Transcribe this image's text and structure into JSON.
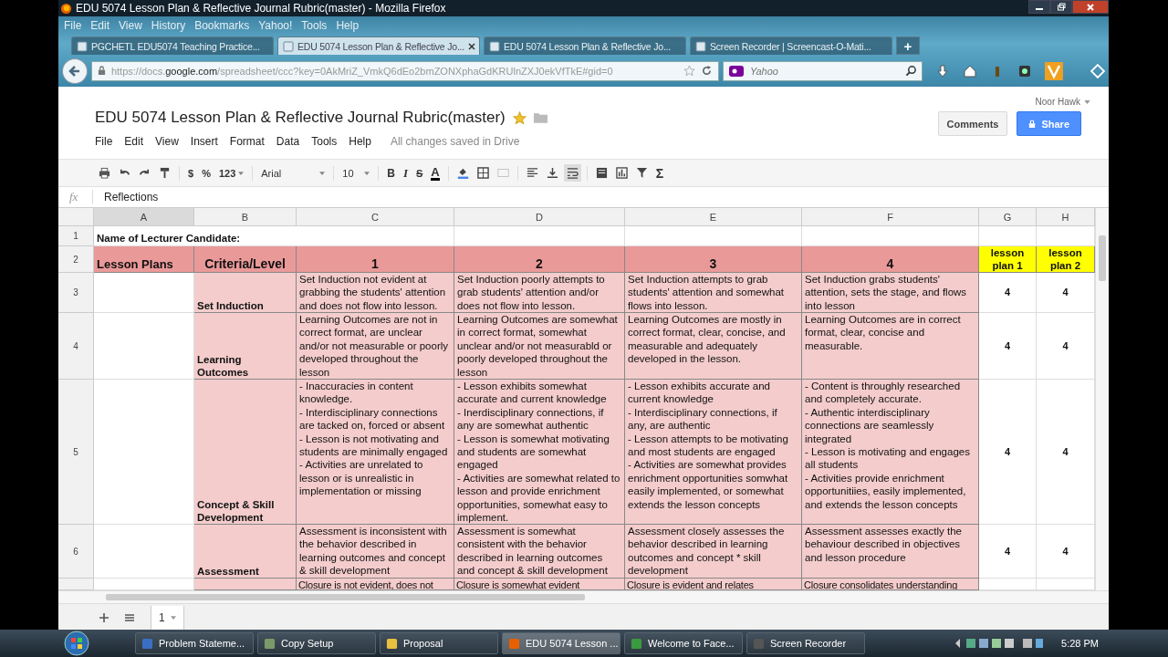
{
  "window": {
    "title": "EDU 5074 Lesson Plan & Reflective Journal Rubric(master) - Mozilla Firefox"
  },
  "menu": [
    "File",
    "Edit",
    "View",
    "History",
    "Bookmarks",
    "Yahoo!",
    "Tools",
    "Help"
  ],
  "tabs": [
    {
      "label": "PGCHETL EDU5074 Teaching Practice...",
      "selected": false
    },
    {
      "label": "EDU 5074 Lesson Plan & Reflective Jo...",
      "selected": true
    },
    {
      "label": "EDU 5074 Lesson Plan & Reflective Jo...",
      "selected": false
    },
    {
      "label": "Screen Recorder | Screencast-O-Mati...",
      "selected": false
    }
  ],
  "new_tab": "+",
  "url": "https://docs.**google.com**/spreadsheet/ccc?key=0AkMriZ_VmkQ6dEo2bmZONXphaGdKRUlnZXJ0ekVfTkE#gid=0",
  "search": {
    "placeholder": "Yahoo"
  },
  "doc": {
    "title": "EDU 5074 Lesson Plan & Reflective Journal Rubric(master)",
    "starred": true,
    "user": "Noor Hawk",
    "menus": [
      "File",
      "Edit",
      "View",
      "Insert",
      "Format",
      "Data",
      "Tools",
      "Help"
    ],
    "save_status": "All changes saved in Drive",
    "comments": "Comments",
    "share": "Share"
  },
  "toolbar": {
    "currency": "$",
    "percent": "%",
    "number_format": "123",
    "font": "Arial",
    "size": "10",
    "bold": "B",
    "italic": "I",
    "strike": "S",
    "text_color": "A",
    "functions": "Σ"
  },
  "formula": {
    "label": "fx",
    "value": "Reflections"
  },
  "columns": [
    {
      "label": "A",
      "selected": true
    },
    {
      "label": "B",
      "selected": false
    },
    {
      "label": "C",
      "selected": false
    },
    {
      "label": "D",
      "selected": false
    },
    {
      "label": "E",
      "selected": false
    },
    {
      "label": "F",
      "selected": false
    },
    {
      "label": "G",
      "selected": false
    },
    {
      "label": "H",
      "selected": false
    }
  ],
  "rows": [
    {
      "number": "1",
      "cells": [
        {
          "text": "Name of Lecturer Candidate:",
          "kind": "title"
        },
        null,
        null,
        null,
        null,
        null,
        null,
        null
      ]
    },
    {
      "number": "2",
      "cells": [
        {
          "text": "Lesson Plans",
          "kind": "head-left"
        },
        {
          "text": "Criteria/Level",
          "kind": "head"
        },
        {
          "text": "1",
          "kind": "head"
        },
        {
          "text": "2",
          "kind": "head"
        },
        {
          "text": "3",
          "kind": "head"
        },
        {
          "text": "4",
          "kind": "head"
        },
        {
          "text": "lesson plan 1",
          "kind": "tag"
        },
        {
          "text": "lesson plan 2",
          "kind": "tag"
        }
      ]
    },
    {
      "number": "3",
      "cells": [
        null,
        {
          "text": "Set Induction",
          "kind": "crit"
        },
        {
          "text": "Set Induction not evident at grabbing the students' attention and does not flow into lesson.",
          "kind": "desc"
        },
        {
          "text": "Set Induction poorly attempts to grab students' attention and/or does not flow into lesson.",
          "kind": "desc"
        },
        {
          "text": "Set Induction attempts to grab students' attention and somewhat flows into lesson.",
          "kind": "desc"
        },
        {
          "text": "Set Induction grabs students' attention, sets the stage, and flows into lesson",
          "kind": "desc"
        },
        {
          "text": "4",
          "kind": "score"
        },
        {
          "text": "4",
          "kind": "score"
        }
      ]
    },
    {
      "number": "4",
      "cells": [
        null,
        {
          "text": "Learning Outcomes",
          "kind": "crit"
        },
        {
          "text": "Learning Outcomes are not in correct format, are unclear and/or not measurable or poorly developed throughout the lesson",
          "kind": "desc"
        },
        {
          "text": "Learning Outcomes are somewhat in correct format, somewhat unclear and/or not measurabld or poorly developed throughout the lesson",
          "kind": "desc"
        },
        {
          "text": "Learning Outcomes are mostly in correct format, clear, concise, and measurable and adequately developed in the lesson.",
          "kind": "desc"
        },
        {
          "text": "Learning Outcomes are in correct format, clear, concise and measurable.",
          "kind": "desc"
        },
        {
          "text": "4",
          "kind": "score"
        },
        {
          "text": "4",
          "kind": "score"
        }
      ]
    },
    {
      "number": "5",
      "cells": [
        null,
        {
          "text": "Concept & Skill Development",
          "kind": "crit"
        },
        {
          "text": "- Inaccuracies in content knowledge.\n- Interdisciplinary connections are tacked on, forced or absent\n- Lesson is not motivating and students are minimally engaged\n- Activities are unrelated to lesson or is unrealistic in implementation or missing",
          "kind": "desc"
        },
        {
          "text": "- Lesson exhibits somewhat accurate and current knowledge\n- Inerdisciplinary connections, if any are somewhat authentic\n- Lesson is somewhat motivating and students are somewhat engaged\n- Activities are somewhat related to lesson and provide enrichment opportunities, somewhat easy to implement.",
          "kind": "desc"
        },
        {
          "text": "- Lesson exhibits accurate and current knowledge\n- Interdisciplinary connections, if any, are authentic\n- Lesson attempts to be motivating and most students are engaged\n- Activities are somewhat provides enrichment opportunities somwhat easily implemented, or somewhat extends the lesson concepts",
          "kind": "desc"
        },
        {
          "text": "- Content is throughly researched and completely accurate.\n- Authentic interdisciplinary connections are seamlessly integrated\n- Lesson is motivating and engages all students\n- Activities provide enrichment opportunitiies, easily implemented, and extends the lesson concepts",
          "kind": "desc"
        },
        {
          "text": "4",
          "kind": "score"
        },
        {
          "text": "4",
          "kind": "score"
        }
      ]
    },
    {
      "number": "6",
      "cells": [
        null,
        {
          "text": "Assessment",
          "kind": "crit"
        },
        {
          "text": "Assessment is inconsistent with the behavior described in learning outcomes and concept & skill development",
          "kind": "desc"
        },
        {
          "text": "Assessment is somewhat consistent with the behavior described in learning outcomes and concept & skill development",
          "kind": "desc"
        },
        {
          "text": "Assessment closely assesses the behavior described in learning outcomes and concept * skill development",
          "kind": "desc"
        },
        {
          "text": "Assessment assesses exactly the behaviour described in objectives and lesson procedure",
          "kind": "desc"
        },
        {
          "text": "4",
          "kind": "score"
        },
        {
          "text": "4",
          "kind": "score"
        }
      ]
    },
    {
      "cells": [
        null,
        {
          "kind": "crit-empty"
        },
        {
          "text": "Closure is not evident, does not",
          "kind": "desc"
        },
        {
          "text": "Closure is somewhat evident",
          "kind": "desc"
        },
        {
          "text": "Closure is evident and relates",
          "kind": "desc"
        },
        {
          "text": "Closure consolidates understanding",
          "kind": "desc"
        },
        null,
        null
      ]
    }
  ],
  "sheets": [
    {
      "label": "1",
      "selected": true
    }
  ],
  "taskbar": [
    {
      "label": "Problem Stateme...",
      "selected": false
    },
    {
      "label": "Copy Setup",
      "selected": false
    },
    {
      "label": "Proposal",
      "selected": false
    },
    {
      "label": "EDU 5074 Lesson ...",
      "selected": true
    },
    {
      "label": "Welcome to Face...",
      "selected": false
    },
    {
      "label": "Screen Recorder",
      "selected": false
    }
  ],
  "clock": "5:28 PM"
}
